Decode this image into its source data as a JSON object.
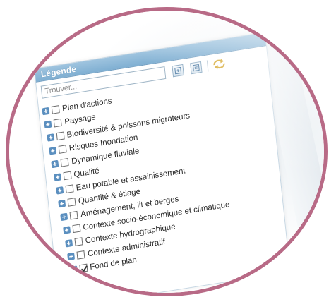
{
  "legend": {
    "title": "Légende",
    "search": {
      "placeholder": "Trouver..."
    },
    "toolbar": [
      {
        "name": "expand-all-button",
        "icon": "expand-icon"
      },
      {
        "name": "collapse-all-button",
        "icon": "collapse-icon"
      },
      {
        "name": "refresh-button",
        "icon": "refresh-icon"
      }
    ],
    "items": [
      {
        "label": "Plan d'actions",
        "checked": false
      },
      {
        "label": "Paysage",
        "checked": false
      },
      {
        "label": "Biodiversité & poissons migrateurs",
        "checked": false
      },
      {
        "label": "Risques Inondation",
        "checked": false
      },
      {
        "label": "Dynamique fluviale",
        "checked": false
      },
      {
        "label": "Qualité",
        "checked": false
      },
      {
        "label": "Eau potable et assainissement",
        "checked": false
      },
      {
        "label": "Quantité & étiage",
        "checked": false
      },
      {
        "label": "Aménagement, lit et berges",
        "checked": false
      },
      {
        "label": "Contexte socio-économique et climatique",
        "checked": false
      },
      {
        "label": "Contexte hydrographique",
        "checked": false
      },
      {
        "label": "Contexte administratif",
        "checked": false
      },
      {
        "label": "Fond de plan",
        "checked": true
      }
    ]
  },
  "colors": {
    "frame_ring": "#b86a86",
    "header": "#8fbadb",
    "expander": "#5b8fbf"
  }
}
